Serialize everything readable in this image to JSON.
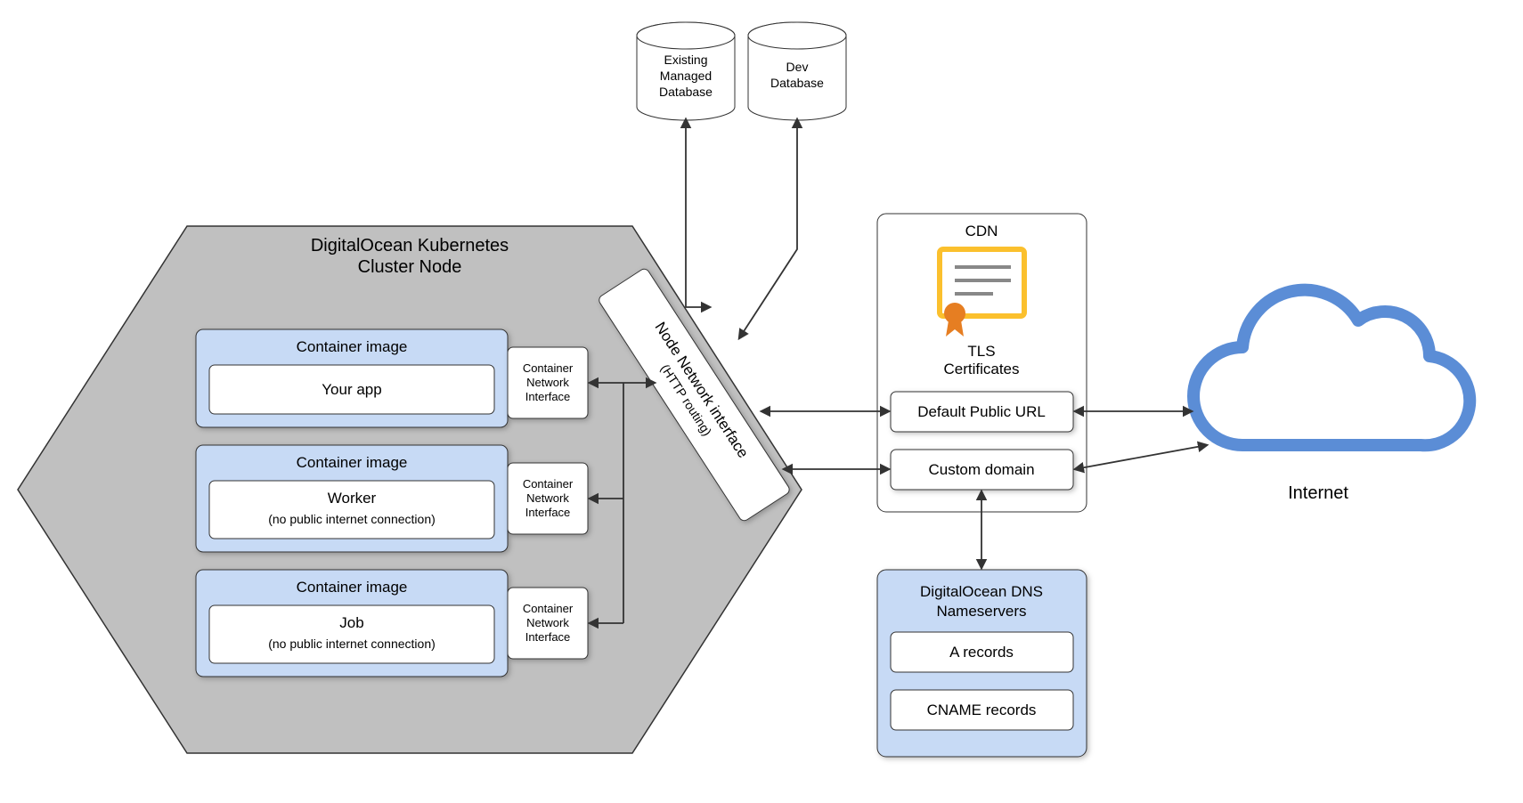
{
  "cluster": {
    "title_l1": "DigitalOcean Kubernetes",
    "title_l2": "Cluster Node",
    "containers": [
      {
        "header": "Container image",
        "main": "Your app",
        "sub": "",
        "cni_l1": "Container",
        "cni_l2": "Network",
        "cni_l3": "Interface"
      },
      {
        "header": "Container image",
        "main": "Worker",
        "sub": "(no public internet connection)",
        "cni_l1": "Container",
        "cni_l2": "Network",
        "cni_l3": "Interface"
      },
      {
        "header": "Container image",
        "main": "Job",
        "sub": "(no public internet connection)",
        "cni_l1": "Container",
        "cni_l2": "Network",
        "cni_l3": "Interface"
      }
    ],
    "node_network_l1": "Node Network interface",
    "node_network_l2": "(HTTP routing)"
  },
  "databases": {
    "existing_l1": "Existing",
    "existing_l2": "Managed",
    "existing_l3": "Database",
    "dev_l1": "Dev",
    "dev_l2": "Database"
  },
  "cdn": {
    "title": "CDN",
    "tls_l1": "TLS",
    "tls_l2": "Certificates",
    "default_url": "Default Public URL",
    "custom_domain": "Custom domain"
  },
  "dns": {
    "title_l1": "DigitalOcean DNS",
    "title_l2": "Nameservers",
    "a_records": "A records",
    "cname_records": "CNAME records"
  },
  "internet": {
    "label": "Internet"
  },
  "colors": {
    "hex_fill": "#C0C0C0",
    "container_fill": "#C7DAF5",
    "dns_fill": "#C7DAF5",
    "white": "#FFFFFF",
    "stroke": "#333333",
    "cloud": "#5B8DD6",
    "cert_yellow": "#FBC02D",
    "cert_orange": "#E67E22"
  }
}
